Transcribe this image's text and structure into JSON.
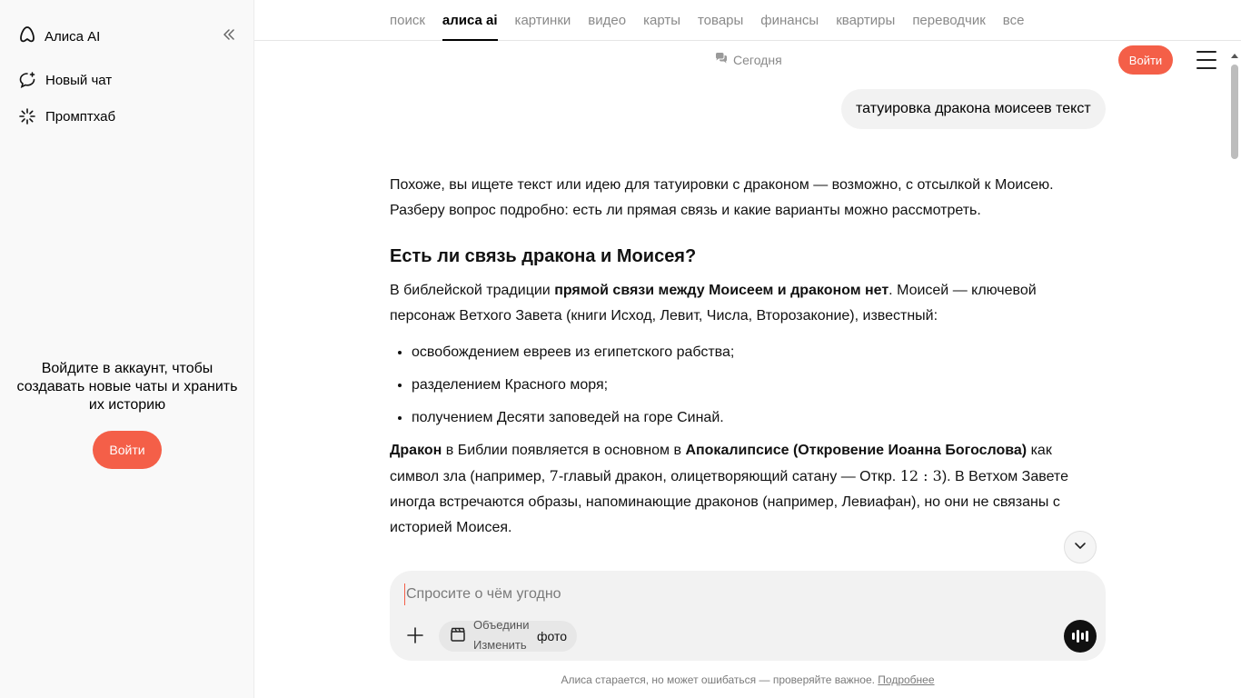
{
  "sidebar": {
    "brand": "Алиса AI",
    "items": [
      {
        "label": "Новый чат",
        "icon": "new-chat-icon"
      },
      {
        "label": "Промптхаб",
        "icon": "sparkle-icon"
      }
    ],
    "login_prompt": "Войдите в аккаунт, чтобы создавать новые чаты и хранить их историю",
    "login_button": "Войти"
  },
  "nav": {
    "tabs": [
      "поиск",
      "алиса ai",
      "картинки",
      "видео",
      "карты",
      "товары",
      "финансы",
      "квартиры",
      "переводчик",
      "все"
    ],
    "active_tab": "алиса ai"
  },
  "header": {
    "today": "Сегодня",
    "login_button": "Войти"
  },
  "chat": {
    "user_message": "татуировка дракона моисеев текст",
    "answer": {
      "intro": "Похоже, вы ищете текст или идею для татуировки с драконом — возможно, с отсылкой к Моисею. Разберу вопрос подробно: есть ли прямая связь и какие варианты можно рассмотреть.",
      "heading": "Есть ли связь дракона и Моисея?",
      "p1_pre": "В библейской традиции ",
      "p1_bold": "прямой связи между Моисеем и драконом нет",
      "p1_post": ". Моисей — ключевой персонаж Ветхого Завета (книги Исход, Левит, Числа, Второзаконие), известный:",
      "bullets": [
        "освобождением евреев из египетского рабства;",
        "разделением Красного моря;",
        "получением Десяти заповедей на горе Синай."
      ],
      "p2_bold1": "Дракон",
      "p2_mid1": " в Библии появляется в основном в ",
      "p2_bold2": "Апокалипсисе (Откровение Иоанна Богослова)",
      "p2_mid2": " как символ зла (например, ",
      "p2_math1": "7",
      "p2_mid3": "-главый дракон, олицетворяющий сатану — Откр. ",
      "p2_math2": "12 : 3",
      "p2_end": "). В Ветхом Завете иногда встречаются образы, напоминающие драконов (например, Левиафан), но они не связаны с историей Моисея."
    }
  },
  "composer": {
    "placeholder": "Спросите о чём угодно",
    "chip_rot_top": "Объедини",
    "chip_rot_bottom": "Изменить",
    "chip_label": "фото"
  },
  "footer": {
    "note": "Алиса старается, но может ошибаться — проверяйте важное. ",
    "link": "Подробнее"
  },
  "colors": {
    "accent": "#f45f48",
    "muted": "#8a8a8a",
    "bubble": "#f2f2f2"
  }
}
